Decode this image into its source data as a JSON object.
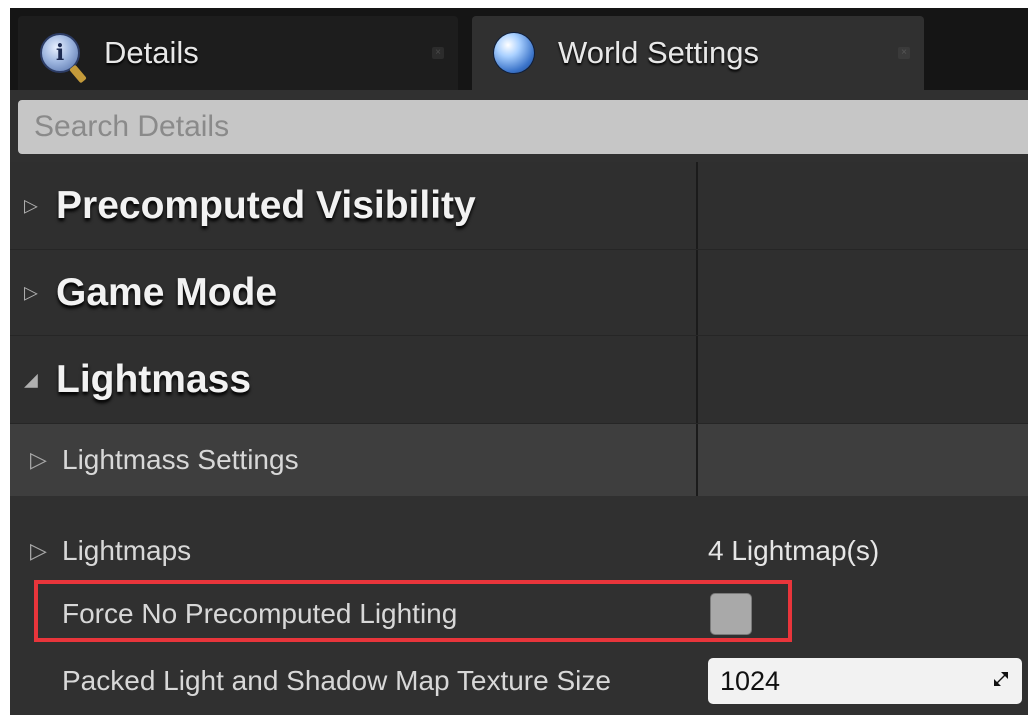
{
  "tabs": [
    {
      "label": "Details",
      "icon": "details-magnifier-icon"
    },
    {
      "label": "World Settings",
      "icon": "world-globe-icon"
    }
  ],
  "search": {
    "placeholder": "Search Details"
  },
  "categories": {
    "precomputed_visibility": "Precomputed Visibility",
    "game_mode": "Game Mode",
    "lightmass": "Lightmass"
  },
  "lightmass_settings": {
    "label": "Lightmass Settings"
  },
  "properties": {
    "lightmaps": {
      "label": "Lightmaps",
      "value": "4 Lightmap(s)"
    },
    "force_no_precomputed_lighting": {
      "label": "Force No Precomputed Lighting",
      "checked": false
    },
    "packed_texture_size": {
      "label": "Packed Light and Shadow Map Texture Size",
      "value": "1024"
    }
  },
  "colors": {
    "highlight": "#e8353b",
    "panel": "#303030",
    "tab_active": "#303030"
  }
}
